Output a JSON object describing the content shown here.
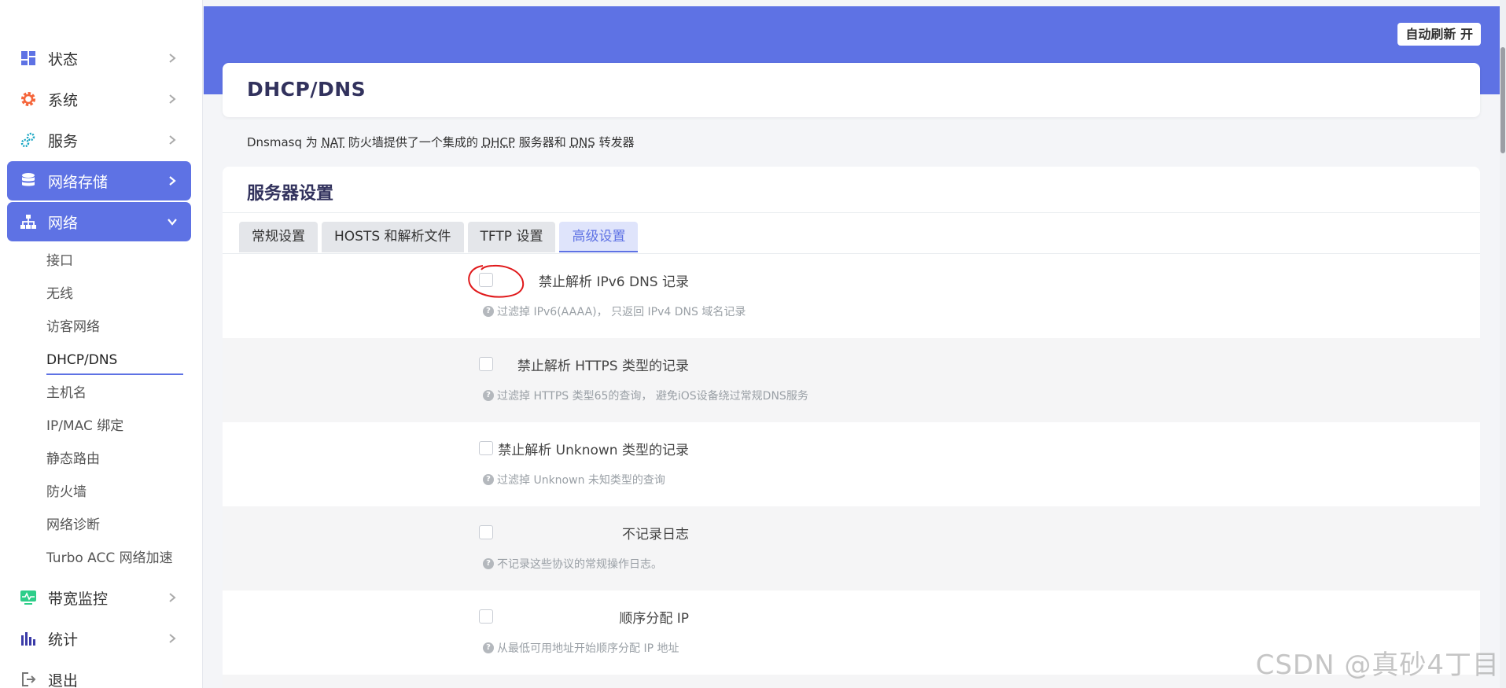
{
  "sidebar": {
    "top_items": [
      {
        "label": "状态",
        "icon": "dashboard-icon"
      },
      {
        "label": "系统",
        "icon": "gear-icon"
      },
      {
        "label": "服务",
        "icon": "services-icon"
      },
      {
        "label": "网络存储",
        "icon": "database-icon"
      },
      {
        "label": "网络",
        "icon": "network-icon"
      }
    ],
    "network_sub_items": [
      "接口",
      "无线",
      "访客网络",
      "DHCP/DNS",
      "主机名",
      "IP/MAC 绑定",
      "静态路由",
      "防火墙",
      "网络诊断",
      "Turbo ACC 网络加速"
    ],
    "bottom_items": [
      {
        "label": "带宽监控",
        "icon": "monitor-icon"
      },
      {
        "label": "统计",
        "icon": "bar-chart-icon"
      },
      {
        "label": "退出",
        "icon": "logout-icon"
      }
    ]
  },
  "header": {
    "refresh_label": "自动刷新 开"
  },
  "page": {
    "title": "DHCP/DNS",
    "description": {
      "p1": "Dnsmasq 为 ",
      "nat": "NAT",
      "p2": " 防火墙提供了一个集成的 ",
      "dhcp": "DHCP",
      "p3": " 服务器和 ",
      "dns": "DNS",
      "p4": " 转发器"
    }
  },
  "settings": {
    "section_title": "服务器设置",
    "tabs": [
      "常规设置",
      "HOSTS 和解析文件",
      "TFTP 设置",
      "高级设置"
    ],
    "rows": [
      {
        "label": "禁止解析 IPv6 DNS 记录",
        "hint": "过滤掉 IPv6(AAAA)， 只返回 IPv4 DNS 域名记录"
      },
      {
        "label": "禁止解析 HTTPS 类型的记录",
        "hint": "过滤掉 HTTPS 类型65的查询， 避免iOS设备绕过常规DNS服务"
      },
      {
        "label": "禁止解析 Unknown 类型的记录",
        "hint": "过滤掉 Unknown 未知类型的查询"
      },
      {
        "label": "不记录日志",
        "hint": "不记录这些协议的常规操作日志。"
      },
      {
        "label": "顺序分配 IP",
        "hint": "从最低可用地址开始顺序分配 IP 地址"
      }
    ]
  },
  "colors": {
    "accent": "#5e72e4",
    "annotation": "#e0191b"
  },
  "watermark": "CSDN @真砂4丁目"
}
